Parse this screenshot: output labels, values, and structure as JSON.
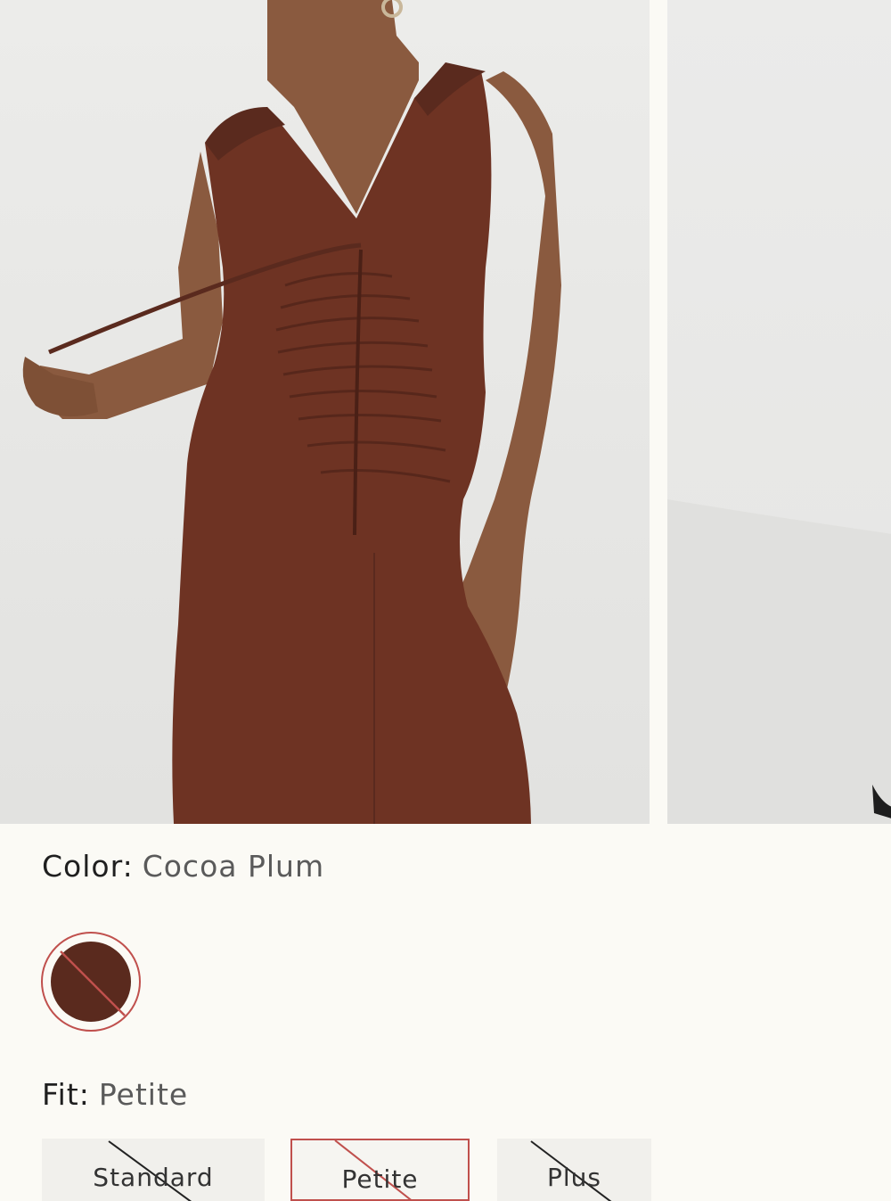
{
  "color": {
    "label": "Color:",
    "value": "Cocoa Plum",
    "swatch_hex": "#5a2a1e",
    "unavailable": true
  },
  "fit": {
    "label": "Fit:",
    "value": "Petite",
    "options": [
      {
        "label": "Standard",
        "selected": false,
        "unavailable": true
      },
      {
        "label": "Petite",
        "selected": true,
        "unavailable": true
      },
      {
        "label": "Plus",
        "selected": false,
        "unavailable": true
      }
    ]
  },
  "colors": {
    "accent": "#c0504d",
    "dress": "#6e3323",
    "background": "#fbfaf5"
  }
}
